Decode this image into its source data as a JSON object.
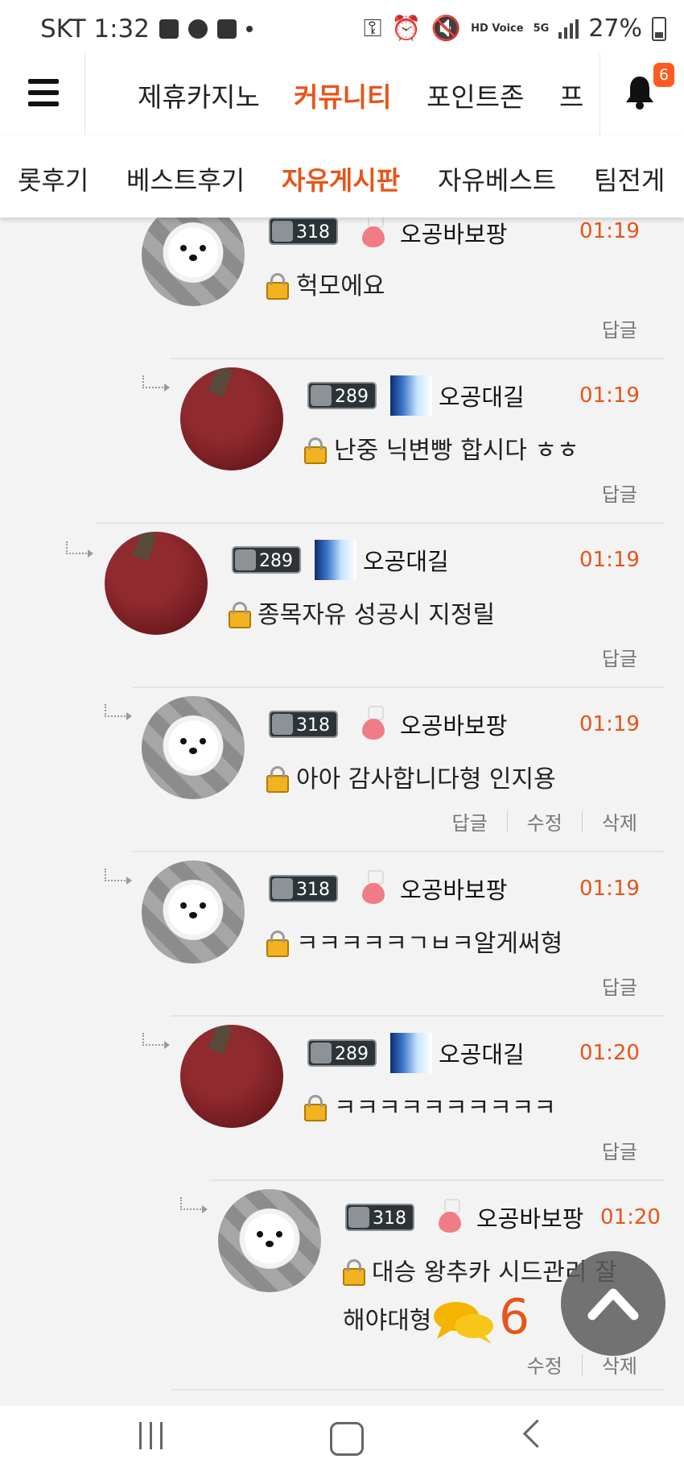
{
  "status_bar": {
    "carrier_time": "SKT 1:32",
    "network_hd": "HD Voice",
    "network_5g": "5G",
    "battery_percent": "27%"
  },
  "nav": {
    "items": [
      "제휴카지노",
      "커뮤니티",
      "포인트존",
      "프"
    ],
    "active_index": 1,
    "notification_count": "6"
  },
  "sub_nav": {
    "items": [
      "롯후기",
      "베스트후기",
      "자유게시판",
      "자유베스트",
      "팀전게"
    ],
    "active_index": 2
  },
  "actions_labels": {
    "reply": "답글",
    "edit": "수정",
    "delete": "삭제"
  },
  "comments": [
    {
      "avatar": "dog",
      "level": "318",
      "tag": "heart",
      "nick": "오공바보팡",
      "time": "01:19",
      "text": "헉모에요",
      "actions": [
        "답글"
      ]
    },
    {
      "avatar": "red",
      "level": "289",
      "tag": "sky",
      "nick": "오공대길",
      "time": "01:19",
      "text": "난중 닉변빵 합시다 ㅎㅎ",
      "actions": [
        "답글"
      ]
    },
    {
      "avatar": "red",
      "level": "289",
      "tag": "sky",
      "nick": "오공대길",
      "time": "01:19",
      "text": "종목자유 성공시 지정릴",
      "actions": [
        "답글"
      ]
    },
    {
      "avatar": "dog",
      "level": "318",
      "tag": "heart",
      "nick": "오공바보팡",
      "time": "01:19",
      "text": "아아 감사합니다형 인지용",
      "actions": [
        "답글",
        "수정",
        "삭제"
      ]
    },
    {
      "avatar": "dog",
      "level": "318",
      "tag": "heart",
      "nick": "오공바보팡",
      "time": "01:19",
      "text": "ㅋㅋㅋㅋㅋㄱㅂㅋ알게써형",
      "actions": [
        "답글"
      ]
    },
    {
      "avatar": "red",
      "level": "289",
      "tag": "sky",
      "nick": "오공대길",
      "time": "01:20",
      "text": "ㅋㅋㅋㅋㅋㅋㅋㅋㅋㅋ",
      "actions": [
        "답글"
      ]
    },
    {
      "avatar": "dog",
      "level": "318",
      "tag": "heart",
      "nick": "오공바보팡",
      "time": "01:20",
      "text": "대승 왕추카 시드관리 잘",
      "text_line2": "해야대형",
      "actions": [
        "수정",
        "삭제"
      ]
    }
  ],
  "floating": {
    "comment_count": "6"
  }
}
